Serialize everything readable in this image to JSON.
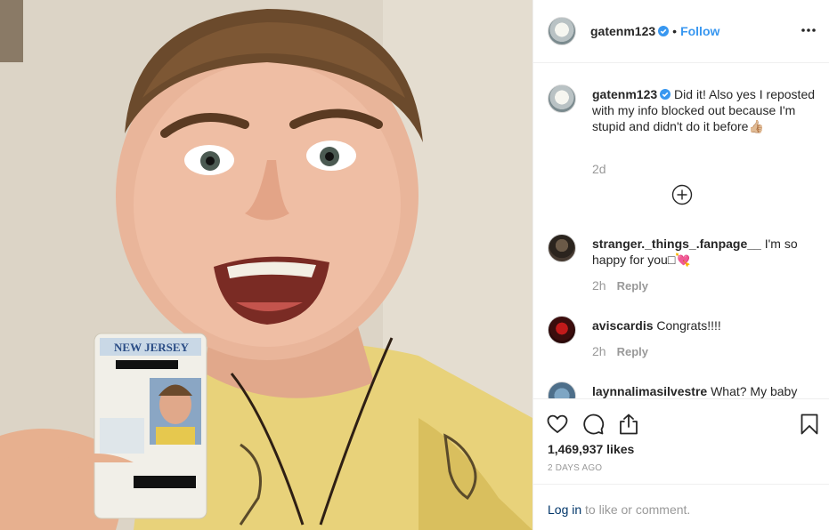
{
  "post": {
    "username": "gatenm123",
    "follow_label": "Follow",
    "separator": "•"
  },
  "caption": {
    "username": "gatenm123",
    "text": "Did it! Also yes I reposted with my info blocked out because I'm stupid and didn't do it before👍🏼",
    "age": "2d"
  },
  "comments": [
    {
      "username": "stranger._things_.fanpage__",
      "text": "I'm so happy for you□💘",
      "age": "2h",
      "reply_label": "Reply"
    },
    {
      "username": "aviscardis",
      "text": "Congrats!!!!",
      "age": "2h",
      "reply_label": "Reply"
    },
    {
      "username": "laynnalimasilvestre",
      "text": "What? My baby"
    }
  ],
  "likes": "1,469,937 likes",
  "timestamp": "2 DAYS AGO",
  "footer": {
    "login_label": "Log in",
    "suffix": " to like or comment."
  },
  "icons": {
    "verified": "verified-badge-icon",
    "more": "more-options-icon",
    "load_more": "plus-circle-icon",
    "like": "heart-icon",
    "comment": "comment-bubble-icon",
    "share": "share-icon",
    "save": "bookmark-icon"
  },
  "colors": {
    "link_blue": "#3897f0",
    "text": "#262626",
    "muted": "#999999"
  }
}
